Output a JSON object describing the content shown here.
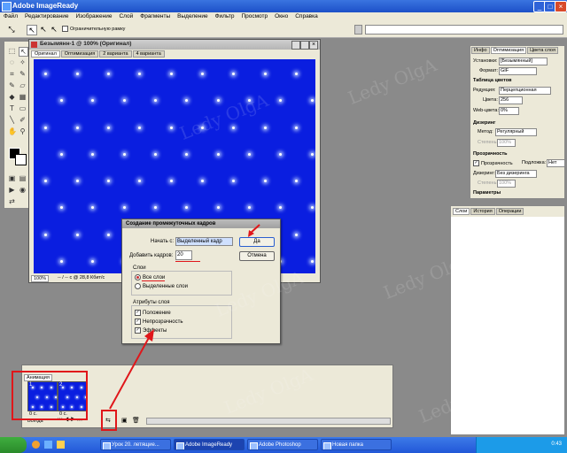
{
  "app": {
    "title": "Adobe ImageReady"
  },
  "menu": [
    "Файл",
    "Редактирование",
    "Изображение",
    "Слой",
    "Фрагменты",
    "Выделение",
    "Фильтр",
    "Просмотр",
    "Окно",
    "Справка"
  ],
  "options": {
    "checkbox_label": "Ограничительную рамку"
  },
  "document": {
    "title": "Безымянн-1 @ 100% (Оригинал)",
    "tabs": [
      "Оригинал",
      "Оптимизация",
      "2 варианта",
      "4 варианта"
    ],
    "zoom": "100%",
    "status": "-- / -- с @ 28,8 Кбит/с"
  },
  "optimize_panel": {
    "tabs": [
      "Инфо",
      "Оптимизация",
      "Цвета слоя"
    ],
    "settings_label": "Установки:",
    "settings_value": "[Безымянный]",
    "format_label": "Формат:",
    "format_value": "GIF",
    "color_table": "Таблица цветов",
    "reduction_label": "Редукция:",
    "reduction_value": "Перцепционная",
    "colors_label": "Цвета:",
    "colors_value": "256",
    "websnap_label": "Web-цвета:",
    "websnap_value": "0%",
    "dither_header": "Дизеринг",
    "method_label": "Метод:",
    "method_value": "Регулярный",
    "amount_label": "Степень:",
    "amount_value": "100%",
    "transparency_header": "Прозрачность",
    "transparency_label": "Прозрачность",
    "matte_label": "Подложка:",
    "matte_value": "Нет",
    "tdither_label": "Дизеринг:",
    "tdither_value": "Без дизеринга",
    "tamount_label": "Степень:",
    "tamount_value": "100%",
    "params": "Параметры"
  },
  "layers_panel": {
    "tabs": [
      "Слои",
      "История",
      "Операции"
    ]
  },
  "dialog": {
    "title": "Создание промежуточных кадров",
    "tween_with_label": "Начать с:",
    "tween_with_value": "Выделенный кадр",
    "frames_label": "Добавить кадров:",
    "frames_value": "20",
    "layers_group": "Слои",
    "all_layers": "Все слои",
    "selected_layers": "Выделенные слои",
    "params_group": "Атрибуты слоя",
    "position": "Положение",
    "opacity": "Непрозрачность",
    "effects": "Эффекты",
    "ok": "Да",
    "cancel": "Отмена"
  },
  "animation": {
    "tab": "Анимация",
    "frames": [
      {
        "num": "1",
        "delay": "0 с."
      },
      {
        "num": "2",
        "delay": "0 с."
      }
    ],
    "loop": "Всегда"
  },
  "taskbar": {
    "items": [
      "Урок 20. летящие...",
      "Adobe ImageReady",
      "Adobe Photoshop",
      "Новая папка"
    ],
    "clock": "0:43"
  },
  "watermark": "Ledy OlgA",
  "colors": {
    "canvas": "#0a1ee0",
    "annotation": "#e0161a"
  }
}
